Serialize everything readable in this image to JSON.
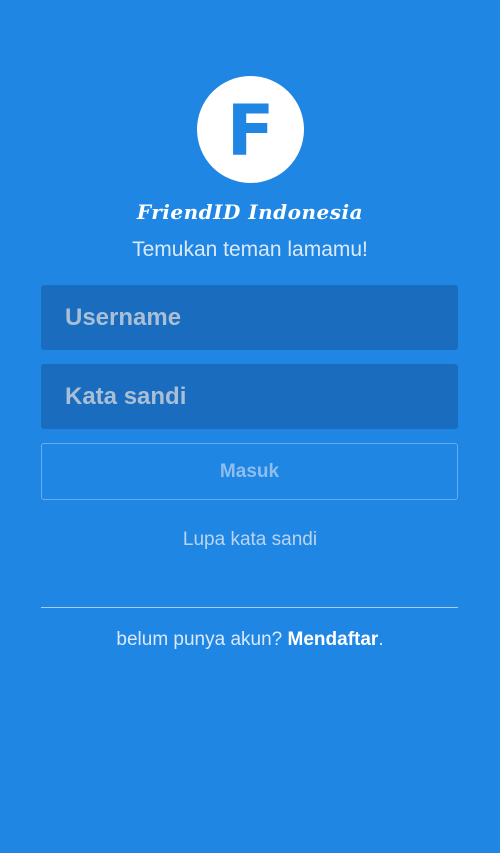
{
  "app": {
    "logo_letter": "F",
    "logo_icon": "friendid-logo-icon",
    "name": "FriendID Indonesia",
    "tagline": "Temukan teman lamamu!"
  },
  "form": {
    "username": {
      "value": "",
      "placeholder": "Username"
    },
    "password": {
      "value": "",
      "placeholder": "Kata sandi"
    },
    "login_label": "Masuk",
    "forgot_label": "Lupa kata sandi"
  },
  "signup": {
    "prompt": "belum punya akun? ",
    "link_label": "Mendaftar",
    "suffix": "."
  },
  "colors": {
    "background": "#1f86e3",
    "field_background": "#1a6cbe",
    "logo_background": "#ffffff"
  }
}
